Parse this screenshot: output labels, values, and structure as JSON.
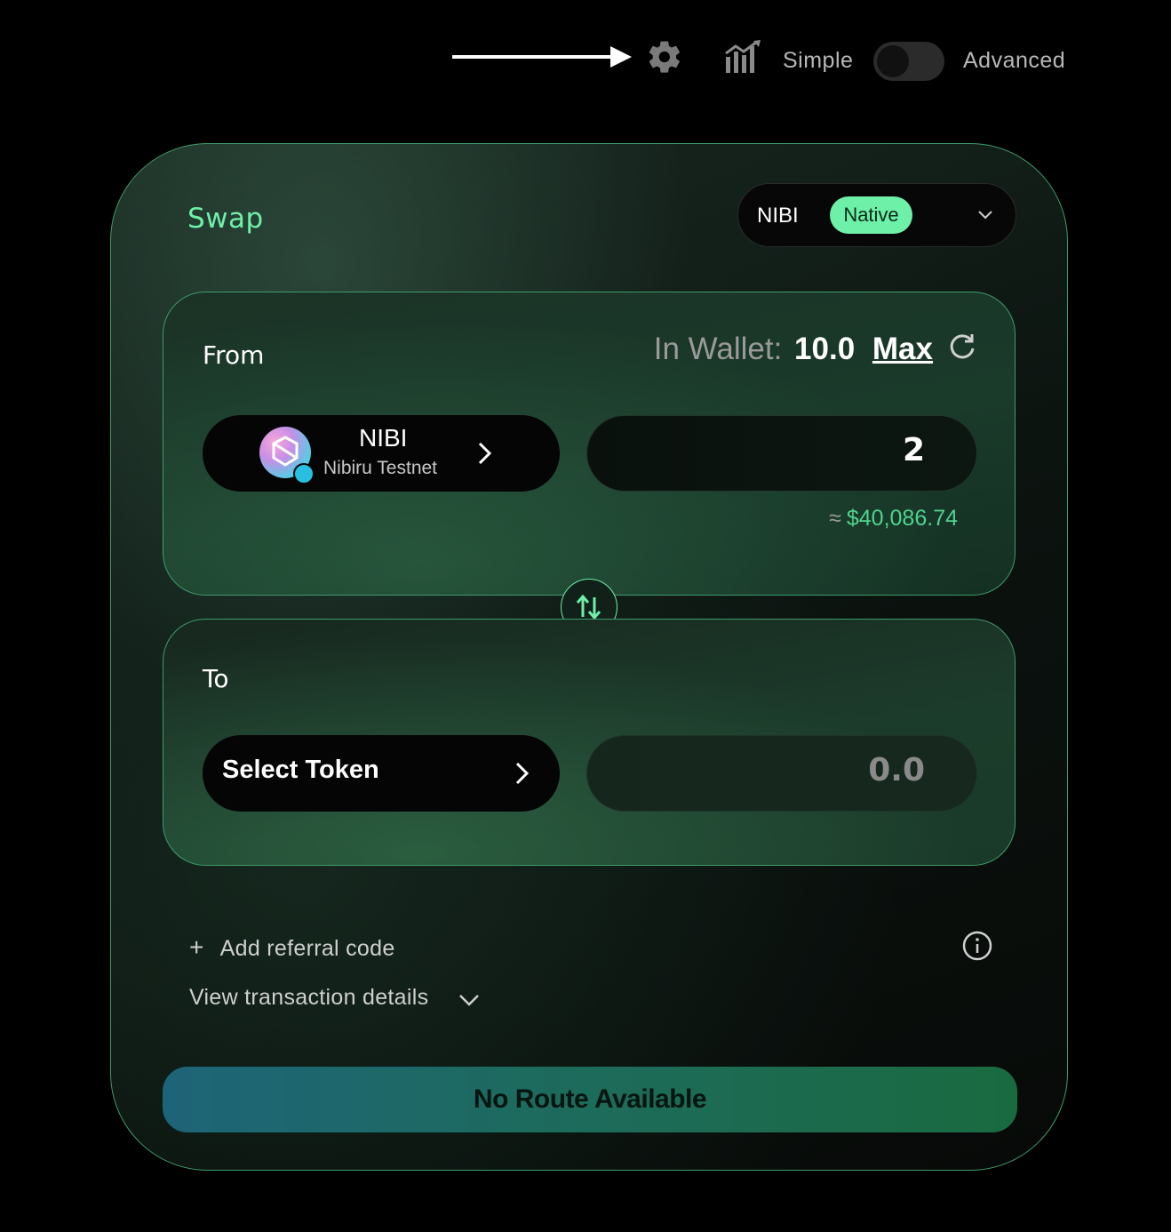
{
  "header": {
    "mode_simple_label": "Simple",
    "mode_advanced_label": "Advanced",
    "mode_toggle_state": "simple",
    "icons": [
      "arrow-right-icon",
      "gear-icon",
      "chart-icon"
    ]
  },
  "swap": {
    "title": "Swap",
    "chain_selector": {
      "chain": "NIBI",
      "badge": "Native"
    },
    "from": {
      "label": "From",
      "wallet_label": "In Wallet:",
      "wallet_amount": "10.0",
      "max_label": "Max",
      "token_symbol": "NIBI",
      "token_network": "Nibiru Testnet",
      "amount": "2",
      "usd_prefix": "≈",
      "usd_value": "$40,086.74"
    },
    "to": {
      "label": "To",
      "select_token_label": "Select Token",
      "amount": "0.0"
    },
    "referral_label": "Add referral code",
    "tx_details_label": "View transaction details",
    "submit_label": "No Route Available"
  },
  "colors": {
    "accent": "#6ef0a8",
    "border": "#3f9b6a",
    "usd": "#4fd38e"
  }
}
